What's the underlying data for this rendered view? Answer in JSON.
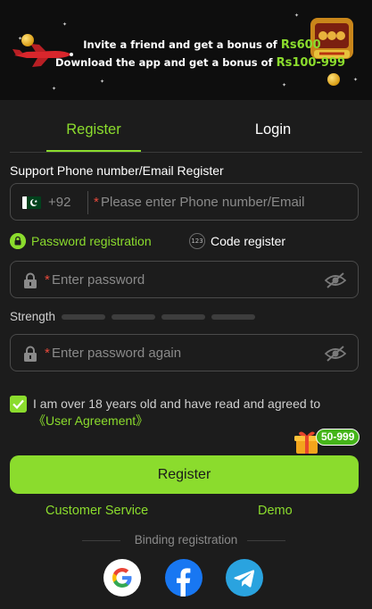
{
  "banner": {
    "line1_text": "Invite a friend and get a bonus of",
    "line1_amount": "Rs600",
    "line2_text": "Download the app and get a bonus of",
    "line2_amount": "Rs100-999"
  },
  "tabs": [
    {
      "label": "Register",
      "active": true
    },
    {
      "label": "Login",
      "active": false
    }
  ],
  "form": {
    "section_label": "Support Phone number/Email Register",
    "phone": {
      "flag_icon": "pakistan-flag-icon",
      "dial_code": "+92",
      "required_mark": "*",
      "placeholder": "Please enter Phone number/Email",
      "value": ""
    },
    "modes": {
      "password_label": "Password registration",
      "code_label": "Code register",
      "code_icon_text": "123"
    },
    "password": {
      "required_mark": "*",
      "placeholder": "Enter password",
      "value": ""
    },
    "strength": {
      "label": "Strength",
      "segments": 4
    },
    "password_confirm": {
      "required_mark": "*",
      "placeholder": "Enter password again",
      "value": ""
    },
    "agreement": {
      "checked": true,
      "text": "I am over 18 years old and have read and agreed to ",
      "link_text": "《User Agreement》"
    },
    "gift_badge": "50-999",
    "register_button": "Register"
  },
  "links": {
    "customer_service": "Customer Service",
    "demo": "Demo"
  },
  "binding": {
    "label": "Binding registration",
    "providers": [
      "google-icon",
      "facebook-icon",
      "telegram-icon"
    ]
  },
  "colors": {
    "accent": "#8bdc2d",
    "background": "#1c1c1c",
    "required": "#e84a3c",
    "badge": "#45b51a"
  }
}
